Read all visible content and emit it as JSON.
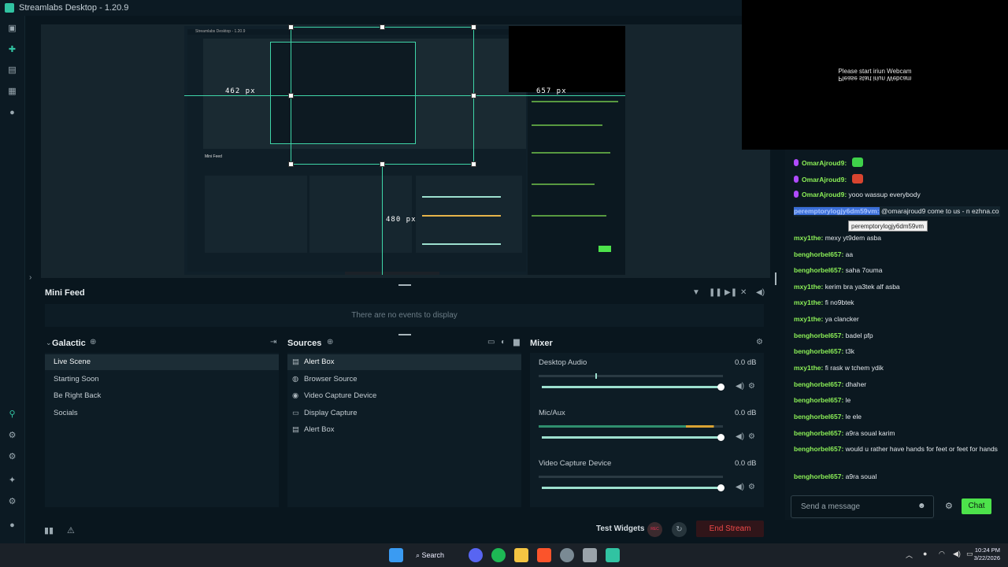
{
  "window": {
    "title": "Streamlabs Desktop - 1.20.9"
  },
  "preview": {
    "label_left": "462 px",
    "label_right": "657 px",
    "label_bottom": "480 px",
    "inner_title": "Streamlabs Desktop - 1.20.9",
    "inner_minifeed": "Mini Feed"
  },
  "webcam": {
    "message_line1": "Please start iriun Webcam",
    "message_line2": "Please start iriun Webcam"
  },
  "chat": {
    "messages": [
      {
        "user": "OmarAjroud9:",
        "text": "",
        "purple": true,
        "emote": "green"
      },
      {
        "user": "OmarAjroud9:",
        "text": "",
        "purple": true,
        "emote": "red"
      },
      {
        "user": "OmarAjroud9:",
        "text": "yooo wassup everybody",
        "purple": true
      },
      {
        "user": "peremptorylogjy6dm59vm:",
        "text": "@omarajroud9 come to us - n ezhna.co",
        "highlight": true
      },
      {
        "user": "mxy1the:",
        "text": "mexy yt9dem asba"
      },
      {
        "user": "benghorbel657:",
        "text": "aa"
      },
      {
        "user": "benghorbel657:",
        "text": "saha 7ouma"
      },
      {
        "user": "mxy1the:",
        "text": "kerim bra ya3tek alf asba"
      },
      {
        "user": "mxy1the:",
        "text": "fi no9btek"
      },
      {
        "user": "mxy1the:",
        "text": "ya clancker"
      },
      {
        "user": "benghorbel657:",
        "text": "badel pfp"
      },
      {
        "user": "benghorbel657:",
        "text": "t3k"
      },
      {
        "user": "mxy1the:",
        "text": "fi rask w tchem ydik"
      },
      {
        "user": "benghorbel657:",
        "text": "dhaher"
      },
      {
        "user": "benghorbel657:",
        "text": "le"
      },
      {
        "user": "benghorbel657:",
        "text": "le ele"
      },
      {
        "user": "benghorbel657:",
        "text": "a9ra soual karim"
      },
      {
        "user": "benghorbel657:",
        "text": "would u rather have hands for feet or feet for hands"
      },
      {
        "user": "benghorbel657:",
        "text": "a9ra soual"
      }
    ],
    "tooltip": "peremptorylogjy6dm59vm",
    "input_placeholder": "Send a message",
    "send_label": "Chat"
  },
  "minifeed": {
    "title": "Mini Feed",
    "empty": "There are no events to display"
  },
  "scenes": {
    "title": "Galactic",
    "items": [
      "Live Scene",
      "Starting Soon",
      "Be Right Back",
      "Socials"
    ],
    "selected": 0
  },
  "sources": {
    "title": "Sources",
    "items": [
      {
        "label": "Alert Box",
        "icon": "alert-icon"
      },
      {
        "label": "Browser Source",
        "icon": "globe-icon"
      },
      {
        "label": "Video Capture Device",
        "icon": "camera-icon"
      },
      {
        "label": "Display Capture",
        "icon": "monitor-icon"
      },
      {
        "label": "Alert Box",
        "icon": "alert-icon"
      }
    ]
  },
  "mixer": {
    "title": "Mixer",
    "channels": [
      {
        "name": "Desktop Audio",
        "db": "0.0 dB",
        "level": 1.0
      },
      {
        "name": "Mic/Aux",
        "db": "0.0 dB",
        "level": 1.0
      },
      {
        "name": "Video Capture Device",
        "db": "0.0 dB",
        "level": 1.0
      }
    ]
  },
  "footer": {
    "test_widgets": "Test Widgets",
    "end_stream": "End Stream",
    "rec": "REC"
  },
  "taskbar": {
    "search": "Search",
    "time": "10:24 PM",
    "date": "3/22/2026"
  },
  "colors": {
    "accent": "#31c3a2",
    "chat_green": "#4de24b",
    "end_stream": "#f04a4a",
    "guide": "#3fd5a8"
  }
}
